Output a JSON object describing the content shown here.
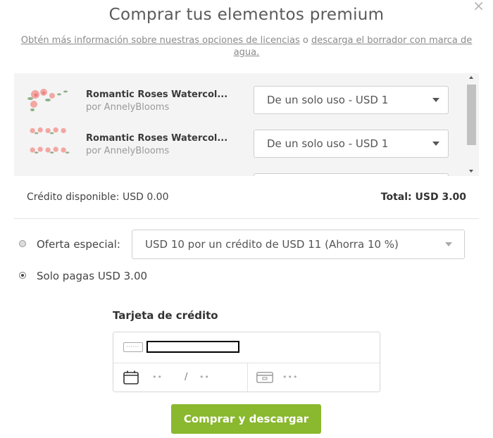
{
  "header": {
    "close": "×",
    "title": "Comprar tus elementos premium",
    "info_link1": "Obtén más información sobre nuestras opciones de licencias",
    "info_connector": " o ",
    "info_link2": "descarga el borrador con marca de agua."
  },
  "items": [
    {
      "name": "Romantic Roses Watercol...",
      "author": "por AnnelyBlooms",
      "license": "De un solo uso - USD 1"
    },
    {
      "name": "Romantic Roses Watercol...",
      "author": "por AnnelyBlooms",
      "license": "De un solo uso - USD 1"
    }
  ],
  "summary": {
    "credit": "Crédito disponible: USD 0.00",
    "total": "Total: USD 3.00"
  },
  "options": {
    "special_label": "Oferta especial:",
    "special_selected": "USD 10 por un crédito de USD 11 (Ahorra 10 %)",
    "pay_label": "Solo pagas USD 3.00"
  },
  "card": {
    "title": "Tarjeta de crédito",
    "expiry_month_placeholder": "••",
    "expiry_separator": "/",
    "expiry_year_placeholder": "••",
    "cvc_placeholder": "•••"
  },
  "actions": {
    "buy_label": "Comprar y descargar"
  },
  "colors": {
    "accent_green": "#8ab82e"
  }
}
